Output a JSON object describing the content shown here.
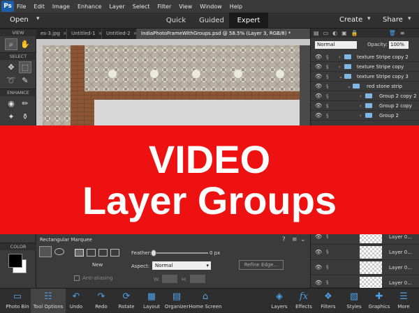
{
  "menubar": {
    "logo": "Ps",
    "items": [
      "File",
      "Edit",
      "Image",
      "Enhance",
      "Layer",
      "Select",
      "Filter",
      "View",
      "Window",
      "Help"
    ]
  },
  "modebar": {
    "open_label": "Open",
    "modes": [
      "Quick",
      "Guided",
      "Expert"
    ],
    "active_mode": "Expert",
    "create_label": "Create",
    "share_label": "Share"
  },
  "toolbox": {
    "sections": [
      "VIEW",
      "SELECT",
      "ENHANCE",
      "COLOR"
    ]
  },
  "tabs": [
    {
      "label": "es-3.jpg"
    },
    {
      "label": "Untitled-1"
    },
    {
      "label": "Untitled-2"
    },
    {
      "label": "IndiaPhotoFrameWithGroups.psd @ 58.5% (Layer 3, RGB/8) *"
    }
  ],
  "layers_panel": {
    "blend_mode": "Normal",
    "opacity_label": "Opacity:",
    "opacity_value": "100%",
    "layers": [
      {
        "name": "texture Stripe copy 2",
        "indent": 0
      },
      {
        "name": "texture Stripe copy",
        "indent": 0
      },
      {
        "name": "texture Stripe copy 3",
        "indent": 0,
        "expanded": true
      },
      {
        "name": "red stone strip",
        "indent": 1,
        "expanded": true
      },
      {
        "name": "Group 2 copy 2",
        "indent": 2
      },
      {
        "name": "Group 2 copy",
        "indent": 2
      },
      {
        "name": "Group 2",
        "indent": 2
      }
    ],
    "bottom_layers": [
      "Layer 0...",
      "Layer 0...",
      "Layer 0...",
      "Layer 0..."
    ]
  },
  "tool_options": {
    "tool_name": "Rectangular Marquee",
    "new_label": "New",
    "anti_alias_label": "Anti-aliasing",
    "feather_label": "Feather:",
    "feather_value": "0 px",
    "feather_fraction": 0,
    "aspect_label": "Aspect:",
    "aspect_value": "Normal",
    "w_label": "W:",
    "h_label": "H:",
    "refine_edge_label": "Refine Edge..."
  },
  "bottombar": {
    "left": [
      {
        "label": "Photo Bin",
        "icon": "photo-bin-icon"
      },
      {
        "label": "Tool Options",
        "icon": "tool-options-icon"
      },
      {
        "label": "Undo",
        "icon": "undo-icon"
      },
      {
        "label": "Redo",
        "icon": "redo-icon"
      },
      {
        "label": "Rotate",
        "icon": "rotate-icon"
      },
      {
        "label": "Layout",
        "icon": "layout-icon"
      },
      {
        "label": "Organizer",
        "icon": "organizer-icon"
      },
      {
        "label": "Home Screen",
        "icon": "home-icon"
      }
    ],
    "right": [
      {
        "label": "Layers",
        "icon": "layers-icon"
      },
      {
        "label": "Effects",
        "icon": "fx-icon"
      },
      {
        "label": "Filters",
        "icon": "filters-icon"
      },
      {
        "label": "Styles",
        "icon": "styles-icon"
      },
      {
        "label": "Graphics",
        "icon": "graphics-icon"
      },
      {
        "label": "More",
        "icon": "more-icon"
      }
    ]
  },
  "banner": {
    "line1": "VIDEO",
    "line2": "Layer Groups",
    "color": "#ee1111"
  },
  "colors": {
    "accent": "#4fa0e8",
    "folder": "#7fb6e6"
  }
}
